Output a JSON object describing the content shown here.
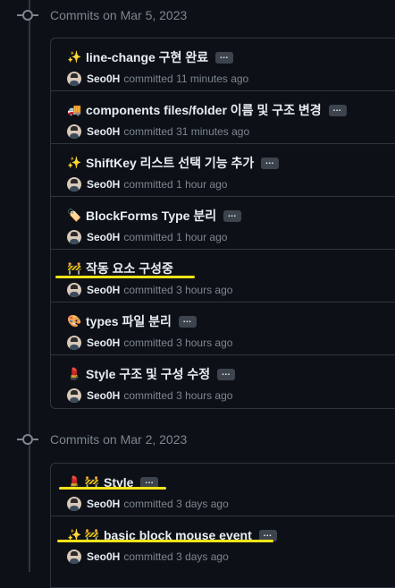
{
  "groups": [
    {
      "title": "Commits on Mar 5, 2023",
      "commits": [
        {
          "emoji": "✨",
          "message": "line-change 구현 완료",
          "author": "Seo0H",
          "committed_label": "committed",
          "time": "11 minutes ago"
        },
        {
          "emoji": "🚚",
          "message": "components files/folder 이름 및 구조 변경",
          "author": "Seo0H",
          "committed_label": "committed",
          "time": "31 minutes ago"
        },
        {
          "emoji": "✨",
          "message": "ShiftKey 리스트 선택 기능 추가",
          "author": "Seo0H",
          "committed_label": "committed",
          "time": "1 hour ago"
        },
        {
          "emoji": "🏷️",
          "message": "BlockForms Type 분리",
          "author": "Seo0H",
          "committed_label": "committed",
          "time": "1 hour ago"
        },
        {
          "emoji": "🚧",
          "message": "작동 요소 구성중",
          "author": "Seo0H",
          "committed_label": "committed",
          "time": "3 hours ago"
        },
        {
          "emoji": "🎨",
          "message": "types 파일 분리",
          "author": "Seo0H",
          "committed_label": "committed",
          "time": "3 hours ago"
        },
        {
          "emoji": "💄",
          "message": "Style 구조 및 구성 수정",
          "author": "Seo0H",
          "committed_label": "committed",
          "time": "3 hours ago"
        }
      ]
    },
    {
      "title": "Commits on Mar 2, 2023",
      "commits": [
        {
          "emoji": "💄 🚧",
          "message": "Style",
          "author": "Seo0H",
          "committed_label": "committed",
          "time": "3 days ago"
        },
        {
          "emoji": "✨ 🚧",
          "message": "basic block mouse event",
          "author": "Seo0H",
          "committed_label": "committed",
          "time": "3 days ago"
        }
      ]
    }
  ],
  "ellipsis_label": "…",
  "colors": {
    "background": "#0d1117",
    "border": "#30363d",
    "muted_text": "#7d8590",
    "highlight": "#f5e31a"
  }
}
